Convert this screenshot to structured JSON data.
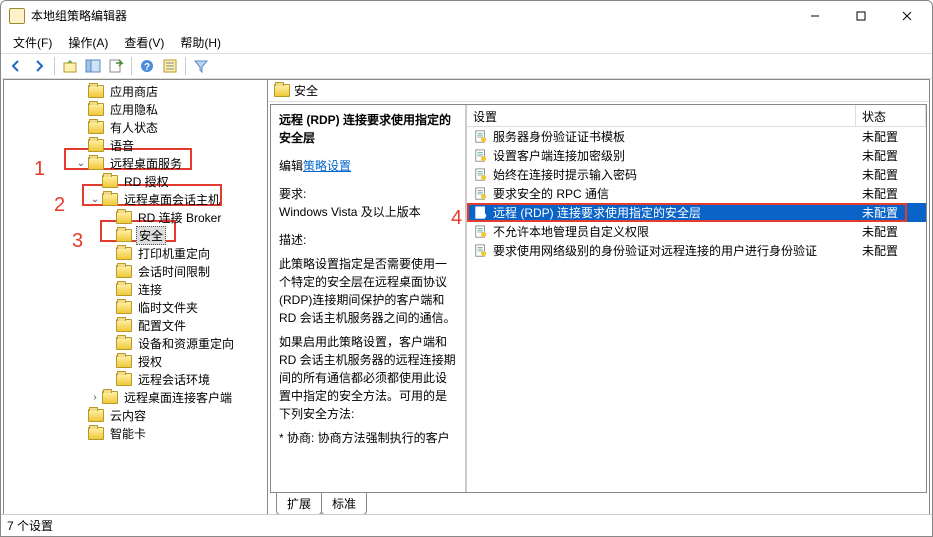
{
  "window": {
    "title": "本地组策略编辑器"
  },
  "menu": {
    "file": "文件(F)",
    "action": "操作(A)",
    "view": "查看(V)",
    "help": "帮助(H)"
  },
  "tree": {
    "items": [
      {
        "indent": 5,
        "label": "应用商店",
        "toggle": ""
      },
      {
        "indent": 5,
        "label": "应用隐私",
        "toggle": ""
      },
      {
        "indent": 5,
        "label": "有人状态",
        "toggle": ""
      },
      {
        "indent": 5,
        "label": "语音",
        "toggle": ""
      },
      {
        "indent": 5,
        "label": "远程桌面服务",
        "toggle": "v"
      },
      {
        "indent": 6,
        "label": "RD 授权",
        "toggle": ""
      },
      {
        "indent": 6,
        "label": "远程桌面会话主机",
        "toggle": "v"
      },
      {
        "indent": 7,
        "label": "RD 连接 Broker",
        "toggle": ""
      },
      {
        "indent": 7,
        "label": "安全",
        "toggle": "",
        "selected": true
      },
      {
        "indent": 7,
        "label": "打印机重定向",
        "toggle": ""
      },
      {
        "indent": 7,
        "label": "会话时间限制",
        "toggle": ""
      },
      {
        "indent": 7,
        "label": "连接",
        "toggle": ""
      },
      {
        "indent": 7,
        "label": "临时文件夹",
        "toggle": ""
      },
      {
        "indent": 7,
        "label": "配置文件",
        "toggle": ""
      },
      {
        "indent": 7,
        "label": "设备和资源重定向",
        "toggle": ""
      },
      {
        "indent": 7,
        "label": "授权",
        "toggle": ""
      },
      {
        "indent": 7,
        "label": "远程会话环境",
        "toggle": ""
      },
      {
        "indent": 6,
        "label": "远程桌面连接客户端",
        "toggle": ">"
      },
      {
        "indent": 5,
        "label": "云内容",
        "toggle": ""
      },
      {
        "indent": 5,
        "label": "智能卡",
        "toggle": ""
      }
    ]
  },
  "annotations": {
    "n1": "1",
    "n2": "2",
    "n3": "3",
    "n4": "4"
  },
  "path_header": {
    "title": "安全"
  },
  "description": {
    "heading": "远程 (RDP) 连接要求使用指定的安全层",
    "edit_prefix": "编辑",
    "edit_link": "策略设置",
    "req_label": "要求:",
    "req_value": "Windows Vista 及以上版本",
    "desc_label": "描述:",
    "desc_p1": "此策略设置指定是否需要使用一个特定的安全层在远程桌面协议(RDP)连接期间保护的客户端和 RD 会话主机服务器之间的通信。",
    "desc_p2": "如果启用此策略设置，客户端和 RD 会话主机服务器的远程连接期间的所有通信都必须都使用此设置中指定的安全方法。可用的是下列安全方法:",
    "desc_p3": "* 协商: 协商方法强制执行的客户"
  },
  "list": {
    "col_setting": "设置",
    "col_status": "状态",
    "rows": [
      {
        "name": "服务器身份验证证书模板",
        "status": "未配置"
      },
      {
        "name": "设置客户端连接加密级别",
        "status": "未配置"
      },
      {
        "name": "始终在连接时提示输入密码",
        "status": "未配置"
      },
      {
        "name": "要求安全的 RPC 通信",
        "status": "未配置"
      },
      {
        "name": "远程 (RDP) 连接要求使用指定的安全层",
        "status": "未配置",
        "selected": true
      },
      {
        "name": "不允许本地管理员自定义权限",
        "status": "未配置"
      },
      {
        "name": "要求使用网络级别的身份验证对远程连接的用户进行身份验证",
        "status": "未配置"
      }
    ]
  },
  "bottom_tabs": {
    "extended": "扩展",
    "standard": "标准"
  },
  "statusbar": {
    "text": "7 个设置"
  }
}
